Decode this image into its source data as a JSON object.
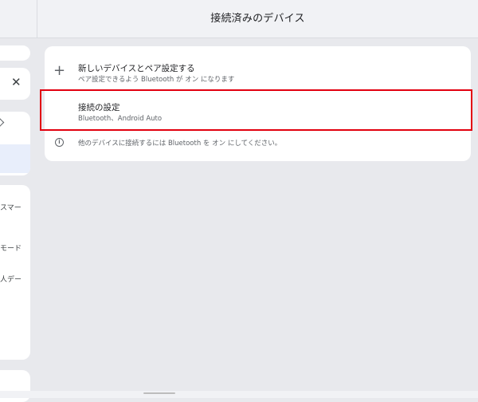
{
  "header": {
    "title": "接続済みのデバイス"
  },
  "sidebar": {
    "close_glyph": "✕",
    "item_labels": [
      "スマー",
      "モード",
      "人デー"
    ]
  },
  "main": {
    "pair_new": {
      "title": "新しいデバイスとペア設定する",
      "subtitle": "ペア設定できるよう Bluetooth が オン になります",
      "icon": "plus-icon"
    },
    "connection_prefs": {
      "title": "接続の設定",
      "subtitle": "Bluetooth、Android Auto"
    },
    "info": {
      "text": "他のデバイスに接続するには Bluetooth を オン にしてください。",
      "icon": "info-icon"
    }
  },
  "colors": {
    "highlight": "#e2000f",
    "background": "#e8e9ed",
    "card": "#ffffff"
  }
}
